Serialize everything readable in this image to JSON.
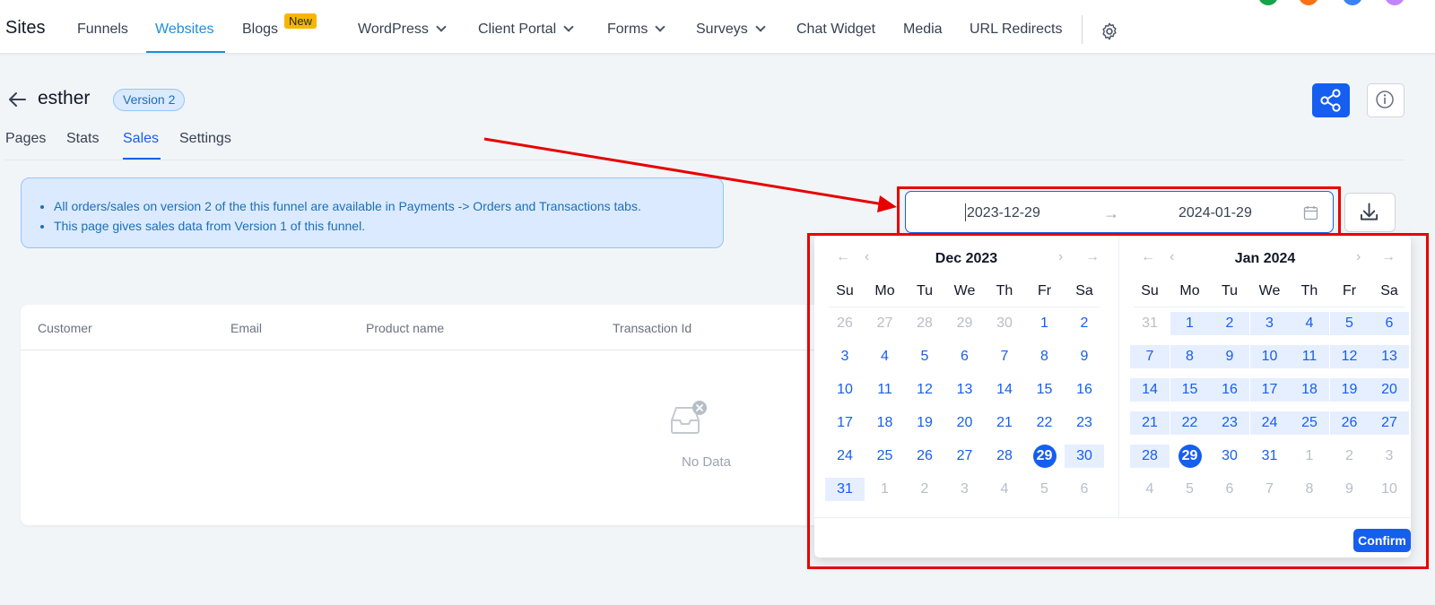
{
  "brand": "Sites",
  "nav": [
    {
      "label": "Funnels"
    },
    {
      "label": "Websites",
      "active": true
    },
    {
      "label": "Blogs",
      "badge": "New"
    },
    {
      "label": "WordPress",
      "dropdown": true
    },
    {
      "label": "Client Portal",
      "dropdown": true
    },
    {
      "label": "Forms",
      "dropdown": true
    },
    {
      "label": "Surveys",
      "dropdown": true
    },
    {
      "label": "Chat Widget"
    },
    {
      "label": "Media"
    },
    {
      "label": "URL Redirects"
    }
  ],
  "site": {
    "name": "esther",
    "version": "Version 2"
  },
  "subtabs": [
    "Pages",
    "Stats",
    "Sales",
    "Settings"
  ],
  "active_subtab": "Sales",
  "notice": [
    "All orders/sales on version 2 of the this funnel are available in Payments -> Orders and Transactions tabs.",
    "This page gives sales data from Version 1 of this funnel."
  ],
  "date_range": {
    "start": "2023-12-29",
    "end": "2024-01-29"
  },
  "table": {
    "columns": [
      "Customer",
      "Email",
      "Product name",
      "Transaction Id"
    ],
    "empty_text": "No Data"
  },
  "calendar": {
    "weekdays": [
      "Su",
      "Mo",
      "Tu",
      "We",
      "Th",
      "Fr",
      "Sa"
    ],
    "months": [
      {
        "title": "Dec 2023",
        "weeks": [
          [
            "26",
            "27",
            "28",
            "29",
            "30",
            "1",
            "2"
          ],
          [
            "3",
            "4",
            "5",
            "6",
            "7",
            "8",
            "9"
          ],
          [
            "10",
            "11",
            "12",
            "13",
            "14",
            "15",
            "16"
          ],
          [
            "17",
            "18",
            "19",
            "20",
            "21",
            "22",
            "23"
          ],
          [
            "24",
            "25",
            "26",
            "27",
            "28",
            "29",
            "30"
          ],
          [
            "31",
            "1",
            "2",
            "3",
            "4",
            "5",
            "6"
          ]
        ],
        "in_month_range": [
          [
            0,
            5
          ],
          [
            5,
            0
          ]
        ],
        "range_cells": [
          [
            4,
            6
          ],
          [
            5,
            0
          ]
        ],
        "selected": [
          4,
          5
        ]
      },
      {
        "title": "Jan 2024",
        "weeks": [
          [
            "31",
            "1",
            "2",
            "3",
            "4",
            "5",
            "6"
          ],
          [
            "7",
            "8",
            "9",
            "10",
            "11",
            "12",
            "13"
          ],
          [
            "14",
            "15",
            "16",
            "17",
            "18",
            "19",
            "20"
          ],
          [
            "21",
            "22",
            "23",
            "24",
            "25",
            "26",
            "27"
          ],
          [
            "28",
            "29",
            "30",
            "31",
            "1",
            "2",
            "3"
          ],
          [
            "4",
            "5",
            "6",
            "7",
            "8",
            "9",
            "10"
          ]
        ],
        "in_month_range": [
          [
            0,
            1
          ],
          [
            4,
            3
          ]
        ],
        "range_cells": [
          [
            0,
            1
          ],
          [
            4,
            0
          ]
        ],
        "selected": [
          4,
          1
        ]
      }
    ],
    "confirm_label": "Confirm"
  },
  "colors": {
    "accent": "#155eef",
    "nav_active": "#1d8fd6",
    "badge": "#f8b500",
    "annotation": "#e80000"
  }
}
